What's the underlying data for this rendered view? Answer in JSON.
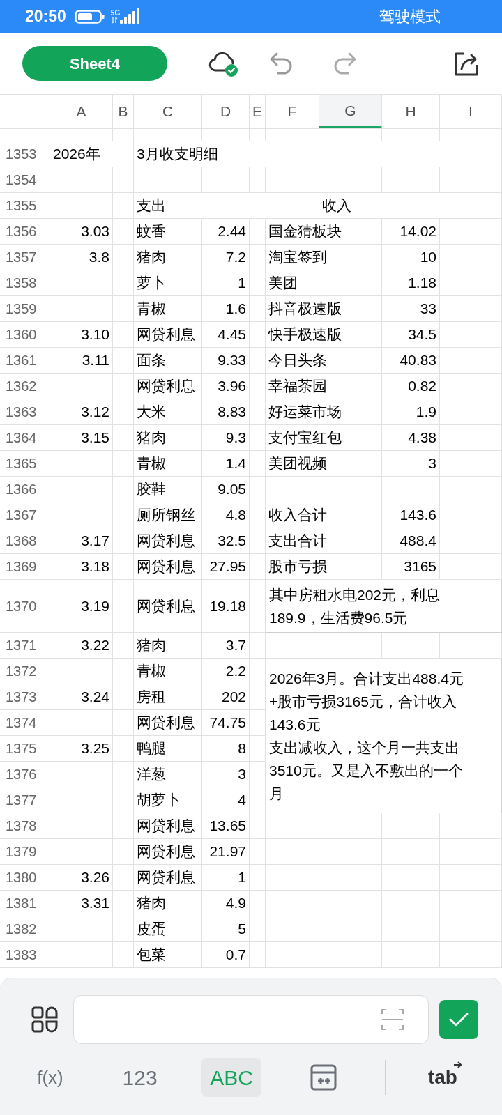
{
  "status_bar": {
    "time": "20:50",
    "network": "5G",
    "mode": "驾驶模式"
  },
  "toolbar": {
    "sheet_name": "Sheet4"
  },
  "columns": [
    {
      "label": "A",
      "selected": false
    },
    {
      "label": "B",
      "selected": false
    },
    {
      "label": "C",
      "selected": false
    },
    {
      "label": "D",
      "selected": false
    },
    {
      "label": "E",
      "selected": false
    },
    {
      "label": "F",
      "selected": false
    },
    {
      "label": "G",
      "selected": true
    },
    {
      "label": "H",
      "selected": false
    },
    {
      "label": "I",
      "selected": false
    }
  ],
  "rows": [
    {
      "number": "1353",
      "year": "2026年",
      "title": "3月收支明细"
    },
    {
      "number": "1354"
    },
    {
      "number": "1355",
      "expense_heading": "支出",
      "income_heading": "收入"
    },
    {
      "number": "1356",
      "date": "3.03",
      "item": "蚊香",
      "amount": "2.44",
      "source": "国金猜板块",
      "income": "14.02"
    },
    {
      "number": "1357",
      "date": "3.8",
      "item": "猪肉",
      "amount": "7.2",
      "source": "淘宝签到",
      "income": "10"
    },
    {
      "number": "1358",
      "item": "萝卜",
      "amount": "1",
      "source": "美团",
      "income": "1.18"
    },
    {
      "number": "1359",
      "item": "青椒",
      "amount": "1.6",
      "source": "抖音极速版",
      "income": "33"
    },
    {
      "number": "1360",
      "date": "3.10",
      "item": "网贷利息",
      "amount": "4.45",
      "source": "快手极速版",
      "income": "34.5"
    },
    {
      "number": "1361",
      "date": "3.11",
      "item": "面条",
      "amount": "9.33",
      "source": "今日头条",
      "income": "40.83"
    },
    {
      "number": "1362",
      "item": "网贷利息",
      "amount": "3.96",
      "source": "幸福茶园",
      "income": "0.82"
    },
    {
      "number": "1363",
      "date": "3.12",
      "item": "大米",
      "amount": "8.83",
      "source": "好运菜市场",
      "income": "1.9"
    },
    {
      "number": "1364",
      "date": "3.15",
      "item": "猪肉",
      "amount": "9.3",
      "source": "支付宝红包",
      "income": "4.38"
    },
    {
      "number": "1365",
      "item": "青椒",
      "amount": "1.4",
      "source": "美团视频",
      "income": "3"
    },
    {
      "number": "1366",
      "item": "胶鞋",
      "amount": "9.05"
    },
    {
      "number": "1367",
      "item": "厕所钢丝",
      "amount": "4.8",
      "source": "收入合计",
      "income": "143.6"
    },
    {
      "number": "1368",
      "date": "3.17",
      "item": "网贷利息",
      "amount": "32.5",
      "source": "支出合计",
      "income": "488.4"
    },
    {
      "number": "1369",
      "date": "3.18",
      "item": "网贷利息",
      "amount": "27.95",
      "source": "股市亏损",
      "income": "3165"
    },
    {
      "number": "1370",
      "date": "3.19",
      "item": "网贷利息",
      "amount": "19.18",
      "note": [
        "其中房租水电202元，利息",
        "189.9，生活费96.5元"
      ]
    },
    {
      "number": "1371",
      "date": "3.22",
      "item": "猪肉",
      "amount": "3.7"
    },
    {
      "number": "1372",
      "item": "青椒",
      "amount": "2.2",
      "note": [
        "2026年3月。合计支出488.4元",
        "+股市亏损3165元，合计收入",
        "143.6元",
        "支出减收入，这个月一共支出",
        "3510元。又是入不敷出的一个",
        "月"
      ]
    },
    {
      "number": "1373",
      "date": "3.24",
      "item": "房租",
      "amount": "202"
    },
    {
      "number": "1374",
      "item": "网贷利息",
      "amount": "74.75"
    },
    {
      "number": "1375",
      "date": "3.25",
      "item": "鸭腿",
      "amount": "8"
    },
    {
      "number": "1376",
      "item": "洋葱",
      "amount": "3"
    },
    {
      "number": "1377",
      "item": "胡萝卜",
      "amount": "4"
    },
    {
      "number": "1378",
      "item": "网贷利息",
      "amount": "13.65"
    },
    {
      "number": "1379",
      "item": "网贷利息",
      "amount": "21.97"
    },
    {
      "number": "1380",
      "date": "3.26",
      "item": "网贷利息",
      "amount": "1"
    },
    {
      "number": "1381",
      "date": "3.31",
      "item": "猪肉",
      "amount": "4.9"
    },
    {
      "number": "1382",
      "item": "皮蛋",
      "amount": "5"
    },
    {
      "number": "1383",
      "item": "包菜",
      "amount": "0.7"
    }
  ],
  "modes": [
    {
      "kind": "formula",
      "label": "f(x)",
      "selected": false
    },
    {
      "kind": "number",
      "label": "123",
      "selected": false
    },
    {
      "kind": "text",
      "label": "ABC",
      "selected": true
    },
    {
      "kind": "table",
      "selected": false
    },
    {
      "kind": "tab",
      "label": "tab",
      "selected": false
    }
  ]
}
